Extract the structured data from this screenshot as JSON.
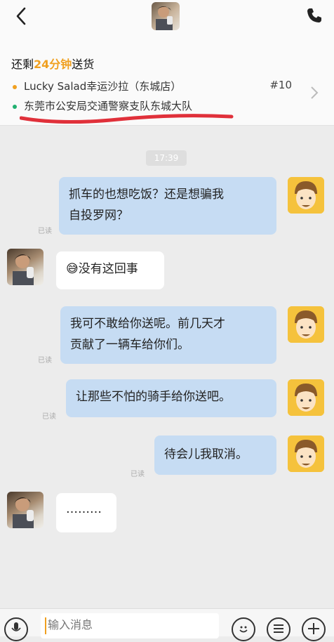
{
  "header": {
    "back_icon": "chevron-left-icon",
    "phone_icon": "phone-icon"
  },
  "order": {
    "title_prefix": "还剩",
    "title_highlight": "24分钟",
    "title_suffix": "送货",
    "shop_name": "Lucky Salad幸运沙拉（东城店）",
    "order_number": "#10",
    "address": "东莞市公安局交通警察支队东城大队",
    "shop_dot_color": "#f0a020",
    "address_dot_color": "#20b070"
  },
  "chat": {
    "time": "17:39",
    "messages": [
      {
        "from": "rider",
        "text_line1": "抓车的也想吃饭？还是想骗我",
        "text_line2": "自投罗网？",
        "status": "已读"
      },
      {
        "from": "user",
        "emoji": "😅",
        "text": "没有这回事"
      },
      {
        "from": "rider",
        "text_line1": "我可不敢给你送呢。前几天才",
        "text_line2": "贡献了一辆车给你们。",
        "status": "已读"
      },
      {
        "from": "rider",
        "text": "让那些不怕的骑手给你送吧。",
        "status": "已读"
      },
      {
        "from": "rider",
        "text": "待会儿我取消。",
        "status": "已读"
      },
      {
        "from": "user",
        "text": "………"
      }
    ]
  },
  "input": {
    "placeholder": "输入消息"
  },
  "colors": {
    "outgoing_bubble": "#c6dcf3",
    "accent": "#f0a020",
    "annotation_red": "#e0303a"
  }
}
